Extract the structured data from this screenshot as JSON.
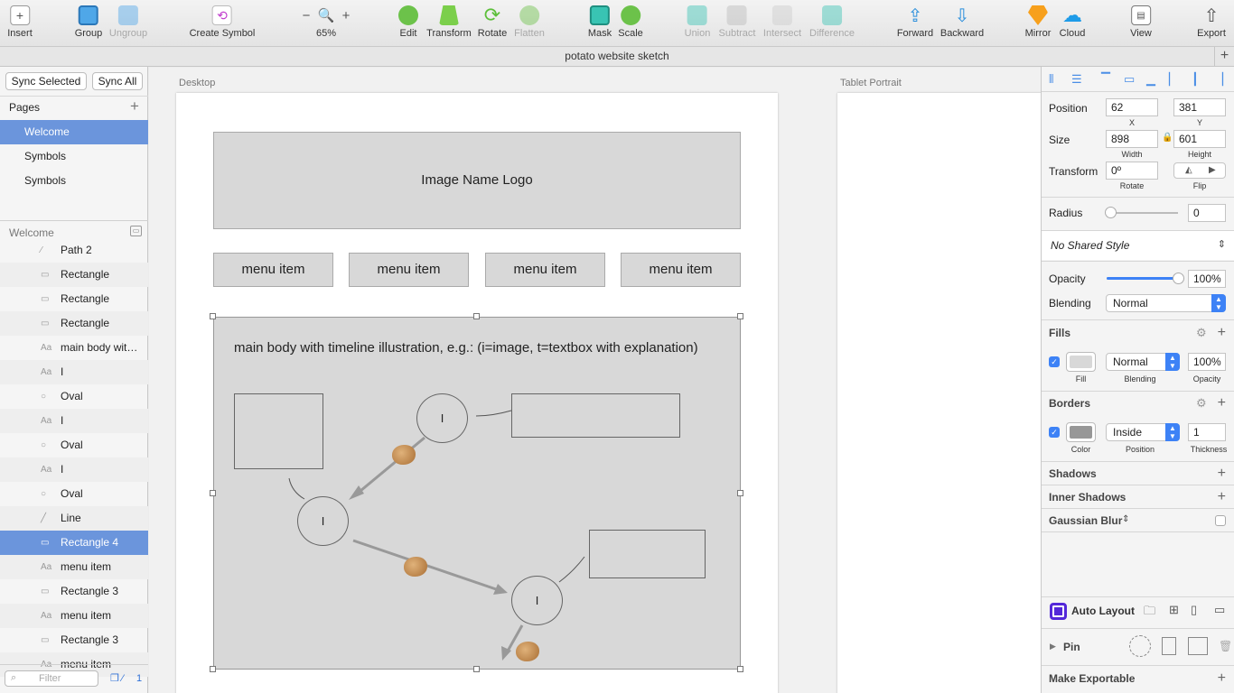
{
  "toolbar": {
    "insert": "Insert",
    "group": "Group",
    "ungroup": "Ungroup",
    "create_symbol": "Create Symbol",
    "zoom": "65%",
    "edit": "Edit",
    "transform": "Transform",
    "rotate": "Rotate",
    "flatten": "Flatten",
    "mask": "Mask",
    "scale": "Scale",
    "union": "Union",
    "subtract": "Subtract",
    "intersect": "Intersect",
    "difference": "Difference",
    "forward": "Forward",
    "backward": "Backward",
    "mirror": "Mirror",
    "cloud": "Cloud",
    "view": "View",
    "export": "Export"
  },
  "document": {
    "title": "potato website sketch"
  },
  "left": {
    "sync_selected": "Sync Selected",
    "sync_all": "Sync All",
    "pages_header": "Pages",
    "pages": [
      "Welcome",
      "Symbols",
      "Symbols"
    ],
    "layers_header": "Welcome",
    "layers": [
      {
        "icon": "path",
        "label": "Path 2"
      },
      {
        "icon": "rect",
        "label": "Rectangle"
      },
      {
        "icon": "rect",
        "label": "Rectangle"
      },
      {
        "icon": "rect",
        "label": "Rectangle"
      },
      {
        "icon": "text",
        "label": "main body wit…"
      },
      {
        "icon": "text",
        "label": "I"
      },
      {
        "icon": "oval",
        "label": "Oval"
      },
      {
        "icon": "text",
        "label": "I"
      },
      {
        "icon": "oval",
        "label": "Oval"
      },
      {
        "icon": "text",
        "label": "I"
      },
      {
        "icon": "oval",
        "label": "Oval"
      },
      {
        "icon": "line",
        "label": "Line"
      },
      {
        "icon": "rect",
        "label": "Rectangle 4"
      },
      {
        "icon": "text",
        "label": "menu item"
      },
      {
        "icon": "rect",
        "label": "Rectangle 3"
      },
      {
        "icon": "text",
        "label": "menu item"
      },
      {
        "icon": "rect",
        "label": "Rectangle 3"
      },
      {
        "icon": "text",
        "label": "menu item"
      }
    ],
    "filter_placeholder": "Filter",
    "filter_count": "1"
  },
  "canvas": {
    "artboard_desktop": "Desktop",
    "artboard_tablet": "Tablet Portrait",
    "logo_text": "Image Name Logo",
    "menu_items": [
      "menu item",
      "menu item",
      "menu item",
      "menu item"
    ],
    "main_text": "main body with timeline illustration, e.g.: (i=image, t=textbox with explanation)",
    "circle_label": "I"
  },
  "inspector": {
    "position_label": "Position",
    "x": "62",
    "y": "381",
    "x_caption": "X",
    "y_caption": "Y",
    "size_label": "Size",
    "width": "898",
    "height": "601",
    "width_caption": "Width",
    "height_caption": "Height",
    "transform_label": "Transform",
    "rotate_value": "0º",
    "rotate_caption": "Rotate",
    "flip_caption": "Flip",
    "radius_label": "Radius",
    "radius_value": "0",
    "shared_style": "No Shared Style",
    "opacity_label": "Opacity",
    "opacity_value": "100%",
    "opacity_fraction": 1.0,
    "blending_label": "Blending",
    "blending_value": "Normal",
    "fills_header": "Fills",
    "fill_caption": "Fill",
    "fill_blending": "Normal",
    "fill_blending_caption": "Blending",
    "fill_opacity": "100%",
    "fill_opacity_caption": "Opacity",
    "fill_color": "#d8d8d8",
    "borders_header": "Borders",
    "border_color_caption": "Color",
    "border_position": "Inside",
    "border_position_caption": "Position",
    "border_thickness": "1",
    "border_thickness_caption": "Thickness",
    "border_color": "#979797",
    "shadows": "Shadows",
    "inner_shadows": "Inner Shadows",
    "gaussian_blur": "Gaussian Blur",
    "auto_layout": "Auto Layout",
    "pin": "Pin",
    "make_exportable": "Make Exportable"
  },
  "colors": {
    "accent": "#3d82f6",
    "selection": "#6b95dc"
  }
}
